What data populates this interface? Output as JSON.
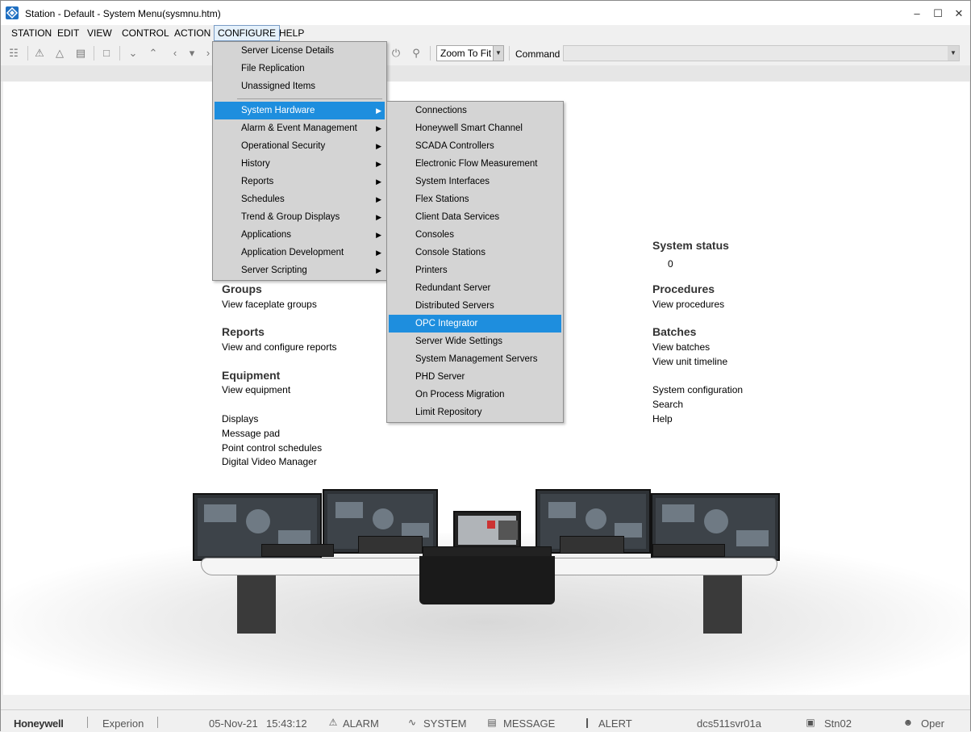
{
  "window": {
    "title": "Station - Default - System Menu(sysmnu.htm)"
  },
  "menubar": [
    "STATION",
    "EDIT",
    "VIEW",
    "CONTROL",
    "ACTION",
    "CONFIGURE",
    "HELP"
  ],
  "toolbar": {
    "zoom_value": "Zoom To Fit",
    "command_label": "Command",
    "command_value": ""
  },
  "content": {
    "groups": {
      "heading": "Groups",
      "link": "View faceplate groups"
    },
    "reports": {
      "heading": "Reports",
      "link": "View and configure reports"
    },
    "equipment": {
      "heading": "Equipment",
      "link": "View equipment"
    },
    "links": [
      "Displays",
      "Message pad",
      "Point control schedules",
      "Digital Video Manager"
    ],
    "system_status": {
      "heading": "System status",
      "value": "0"
    },
    "procedures": {
      "heading": "Procedures",
      "link": "View procedures"
    },
    "batches": {
      "heading": "Batches",
      "links": [
        "View batches",
        "View unit timeline"
      ]
    },
    "right_links": [
      "System configuration",
      "Search",
      "Help"
    ]
  },
  "configure_menu": {
    "top_items": [
      "Server License Details",
      "File Replication",
      "Unassigned Items"
    ],
    "submenu_items": [
      "System Hardware",
      "Alarm & Event Management",
      "Operational Security",
      "History",
      "Reports",
      "Schedules",
      "Trend & Group Displays",
      "Applications",
      "Application Development",
      "Server Scripting"
    ],
    "highlighted": "System Hardware"
  },
  "hardware_menu": {
    "items": [
      "Connections",
      "Honeywell Smart Channel",
      "SCADA Controllers",
      "Electronic Flow Measurement",
      "System Interfaces",
      "Flex Stations",
      "Client Data Services",
      "Consoles",
      "Console Stations",
      "Printers",
      "Redundant Server",
      "Distributed Servers",
      "OPC Integrator",
      "Server Wide Settings",
      "System Management Servers",
      "PHD Server",
      "On Process Migration",
      "Limit Repository"
    ],
    "highlighted": "OPC Integrator"
  },
  "statusbar": {
    "brand": "Honeywell",
    "product": "Experion",
    "date": "05-Nov-21",
    "time": "15:43:12",
    "alarm": "ALARM",
    "system": "SYSTEM",
    "message": "MESSAGE",
    "alert": "ALERT",
    "server": "dcs511svr01a",
    "station": "Stn02",
    "user": "Oper"
  },
  "colors": {
    "highlight": "#1e8ede",
    "menu_bg": "#d4d4d4"
  }
}
